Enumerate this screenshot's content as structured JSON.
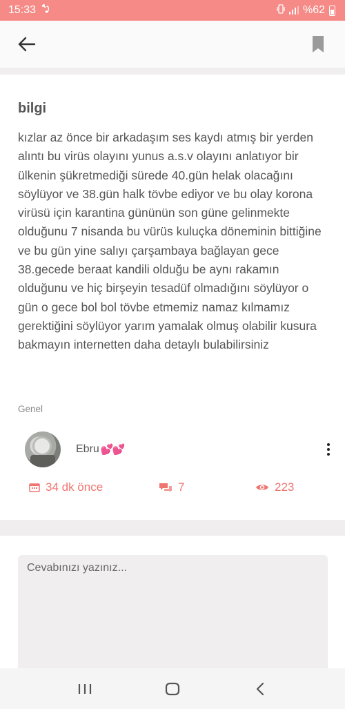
{
  "status_bar": {
    "time": "15:33",
    "battery": "%62",
    "accent_color": "#f58a86"
  },
  "app_bar": {
    "back_icon": "arrow-left-icon",
    "bookmark_icon": "bookmark-icon"
  },
  "post": {
    "title": "bilgi",
    "body": "kızlar az önce bir arkadaşım ses kaydı atmış bir yerden alıntı bu virüs olayını yunus a.s.v olayını anlatıyor bir ülkenin şükretmediği sürede 40.gün helak olacağını söylüyor ve 38.gün halk tövbe ediyor ve bu olay korona virüsü için karantina gününün son güne gelinmekte olduğunu 7 nisanda bu vürüs kuluçka döneminin bittiğine ve bu gün yine salıyı çarşambaya bağlayan gece 38.gecede beraat kandili olduğu be aynı rakamın olduğunu ve hiç birşeyin tesadüf olmadığını söylüyor o gün o gece bol bol tövbe etmemiz namaz kılmamız gerektiğini söylüyor yarım yamalak olmuş olabilir kusura bakmayın internetten daha detaylı bulabilirsiniz",
    "category": "Genel",
    "author": {
      "name": "Ebru",
      "emoji": "💕💕"
    },
    "stats": {
      "time": "34 dk önce",
      "replies": "7",
      "views": "223",
      "accent_color": "#f07570"
    }
  },
  "reply": {
    "placeholder": "Cevabınızı yazınız..."
  },
  "nav_bar": {
    "recents_icon": "recents-icon",
    "home_icon": "home-icon",
    "back_icon": "nav-back-icon"
  }
}
